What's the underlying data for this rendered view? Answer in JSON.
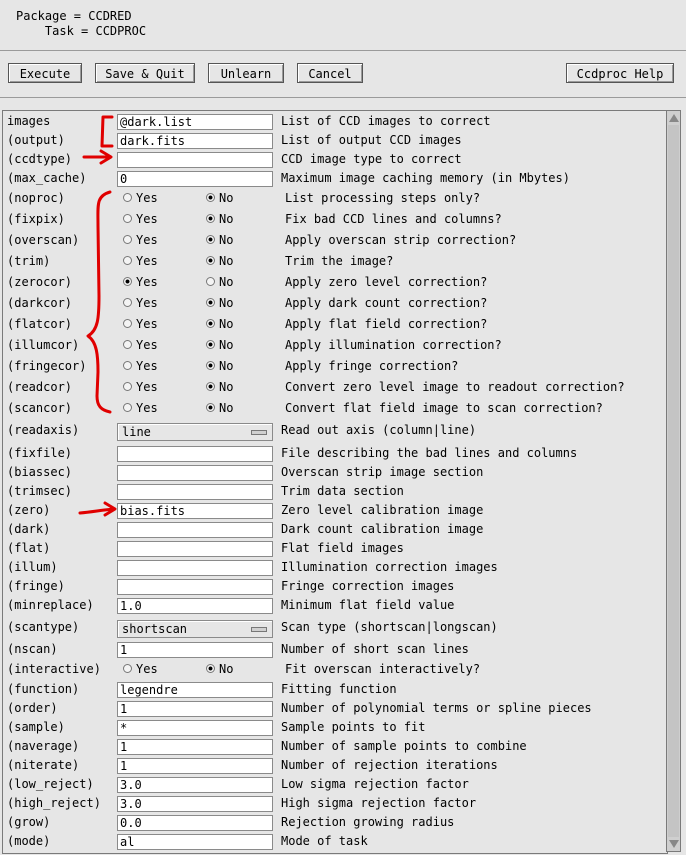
{
  "header": {
    "package_line": "Package = CCDRED",
    "task_line": "    Task = CCDPROC"
  },
  "toolbar": {
    "execute": "Execute",
    "save_quit": "Save & Quit",
    "unlearn": "Unlearn",
    "cancel": "Cancel",
    "help": "Ccdproc Help"
  },
  "yes_label": "Yes",
  "no_label": "No",
  "rows": [
    {
      "type": "text",
      "name": "images",
      "value": "@dark.list",
      "desc": "List of CCD images to correct"
    },
    {
      "type": "text",
      "name": "(output)",
      "value": "dark.fits",
      "desc": "List of output CCD images"
    },
    {
      "type": "text",
      "name": "(ccdtype)",
      "value": "",
      "desc": "CCD image type to correct"
    },
    {
      "type": "text",
      "name": "(max_cache)",
      "value": "0",
      "desc": "Maximum image caching memory (in Mbytes)"
    },
    {
      "type": "bool",
      "name": "(noproc)",
      "selected": "No",
      "desc": "List processing steps only?"
    },
    {
      "type": "bool",
      "name": "(fixpix)",
      "selected": "No",
      "desc": "Fix bad CCD lines and columns?"
    },
    {
      "type": "bool",
      "name": "(overscan)",
      "selected": "No",
      "desc": "Apply overscan strip correction?"
    },
    {
      "type": "bool",
      "name": "(trim)",
      "selected": "No",
      "desc": "Trim the image?"
    },
    {
      "type": "bool",
      "name": "(zerocor)",
      "selected": "Yes",
      "desc": "Apply zero level correction?"
    },
    {
      "type": "bool",
      "name": "(darkcor)",
      "selected": "No",
      "desc": "Apply dark count correction?"
    },
    {
      "type": "bool",
      "name": "(flatcor)",
      "selected": "No",
      "desc": "Apply flat field correction?"
    },
    {
      "type": "bool",
      "name": "(illumcor)",
      "selected": "No",
      "desc": "Apply illumination correction?"
    },
    {
      "type": "bool",
      "name": "(fringecor)",
      "selected": "No",
      "desc": "Apply fringe correction?"
    },
    {
      "type": "bool",
      "name": "(readcor)",
      "selected": "No",
      "desc": "Convert zero level image to readout correction?"
    },
    {
      "type": "bool",
      "name": "(scancor)",
      "selected": "No",
      "desc": "Convert flat field image to scan correction?"
    },
    {
      "type": "select",
      "name": "(readaxis)",
      "value": "line",
      "desc": "Read out axis (column|line)"
    },
    {
      "type": "text",
      "name": "(fixfile)",
      "value": "",
      "desc": "File describing the bad lines and columns"
    },
    {
      "type": "text",
      "name": "(biassec)",
      "value": "",
      "desc": "Overscan strip image section"
    },
    {
      "type": "text",
      "name": "(trimsec)",
      "value": "",
      "desc": "Trim data section"
    },
    {
      "type": "text",
      "name": "(zero)",
      "value": "bias.fits",
      "desc": "Zero level calibration image"
    },
    {
      "type": "text",
      "name": "(dark)",
      "value": "",
      "desc": "Dark count calibration image"
    },
    {
      "type": "text",
      "name": "(flat)",
      "value": "",
      "desc": "Flat field images"
    },
    {
      "type": "text",
      "name": "(illum)",
      "value": "",
      "desc": "Illumination correction images"
    },
    {
      "type": "text",
      "name": "(fringe)",
      "value": "",
      "desc": "Fringe correction images"
    },
    {
      "type": "text",
      "name": "(minreplace)",
      "value": "1.0",
      "desc": "Minimum flat field value"
    },
    {
      "type": "select",
      "name": "(scantype)",
      "value": "shortscan",
      "desc": "Scan type (shortscan|longscan)"
    },
    {
      "type": "text",
      "name": "(nscan)",
      "value": "1",
      "desc": "Number of short scan lines"
    },
    {
      "type": "bool",
      "name": "(interactive)",
      "selected": "No",
      "desc": "Fit overscan interactively?"
    },
    {
      "type": "text",
      "name": "(function)",
      "value": "legendre",
      "desc": "Fitting function"
    },
    {
      "type": "text",
      "name": "(order)",
      "value": "1",
      "desc": "Number of polynomial terms or spline pieces"
    },
    {
      "type": "text",
      "name": "(sample)",
      "value": "*",
      "desc": "Sample points to fit"
    },
    {
      "type": "text",
      "name": "(naverage)",
      "value": "1",
      "desc": "Number of sample points to combine"
    },
    {
      "type": "text",
      "name": "(niterate)",
      "value": "1",
      "desc": "Number of rejection iterations"
    },
    {
      "type": "text",
      "name": "(low_reject)",
      "value": "3.0",
      "desc": "Low sigma rejection factor"
    },
    {
      "type": "text",
      "name": "(high_reject)",
      "value": "3.0",
      "desc": "High sigma rejection factor"
    },
    {
      "type": "text",
      "name": "(grow)",
      "value": "0.0",
      "desc": "Rejection growing radius"
    },
    {
      "type": "text",
      "name": "(mode)",
      "value": "al",
      "desc": "Mode of task"
    }
  ],
  "annotation_color": "#e00000"
}
